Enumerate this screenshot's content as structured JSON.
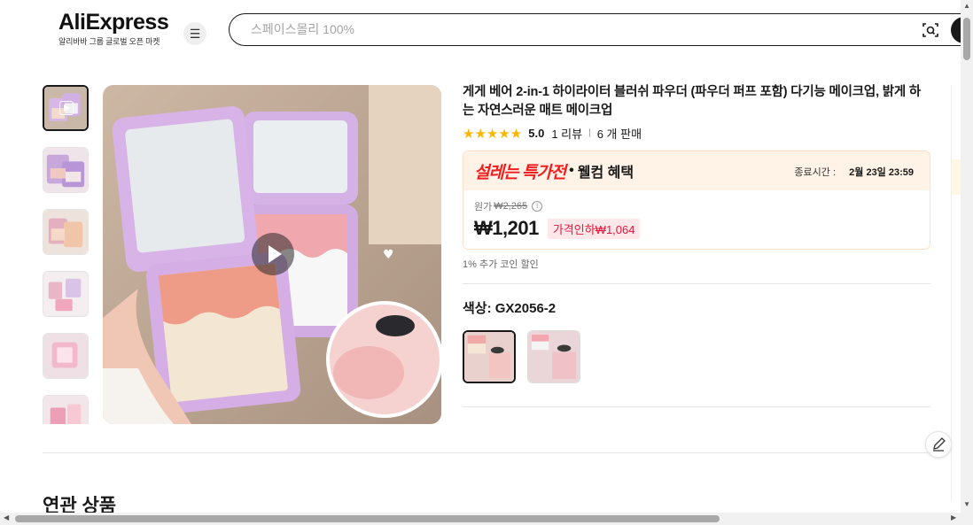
{
  "header": {
    "logo": "AliExpress",
    "logo_sub": "알리바바 그룹 글로벌 오픈 마켓",
    "search_placeholder": "스페이스몰리 100%"
  },
  "product": {
    "title": "게게 베어 2-in-1 하이라이터 블러쉬 파우더 (파우더 퍼프 포함) 다기능 메이크업, 밝게 하는 자연스러운 매트 메이크업",
    "rating": "5.0",
    "reviews": "1 리뷰",
    "sold": "6 개 판매",
    "stars": "★★★★★"
  },
  "promo": {
    "name": "설레는 특가전",
    "dot": "•",
    "welcome": "웰컴 혜택",
    "end_label": "종료시간 :",
    "end_time": "2월 23일 23:59",
    "orig_label": "원가",
    "orig_price": "₩2,265",
    "price": "₩1,201",
    "discount": "가격인하₩1,064"
  },
  "coin_text": "1% 추가 코인 할인",
  "color": {
    "label": "색상: GX2056-2"
  },
  "related_title": "연관 상품",
  "colors": {
    "accent_red": "#ef1f1f",
    "promo_bg": "#fff2e6",
    "discount_bg": "#ffe7ea",
    "star": "#fdb600"
  },
  "icons": [
    "menu-icon",
    "camera-search-icon",
    "play-icon",
    "info-icon",
    "edit-icon"
  ]
}
